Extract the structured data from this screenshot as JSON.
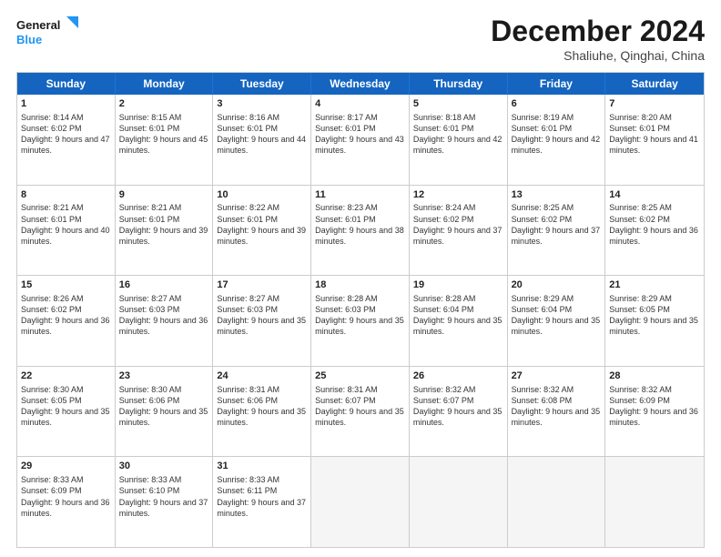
{
  "header": {
    "logo_line1": "General",
    "logo_line2": "Blue",
    "month": "December 2024",
    "location": "Shaliuhe, Qinghai, China"
  },
  "weekdays": [
    "Sunday",
    "Monday",
    "Tuesday",
    "Wednesday",
    "Thursday",
    "Friday",
    "Saturday"
  ],
  "rows": [
    [
      {
        "day": "1",
        "rise": "8:14 AM",
        "set": "6:02 PM",
        "daylight": "9 hours and 47 minutes."
      },
      {
        "day": "2",
        "rise": "8:15 AM",
        "set": "6:01 PM",
        "daylight": "9 hours and 45 minutes."
      },
      {
        "day": "3",
        "rise": "8:16 AM",
        "set": "6:01 PM",
        "daylight": "9 hours and 44 minutes."
      },
      {
        "day": "4",
        "rise": "8:17 AM",
        "set": "6:01 PM",
        "daylight": "9 hours and 43 minutes."
      },
      {
        "day": "5",
        "rise": "8:18 AM",
        "set": "6:01 PM",
        "daylight": "9 hours and 42 minutes."
      },
      {
        "day": "6",
        "rise": "8:19 AM",
        "set": "6:01 PM",
        "daylight": "9 hours and 42 minutes."
      },
      {
        "day": "7",
        "rise": "8:20 AM",
        "set": "6:01 PM",
        "daylight": "9 hours and 41 minutes."
      }
    ],
    [
      {
        "day": "8",
        "rise": "8:21 AM",
        "set": "6:01 PM",
        "daylight": "9 hours and 40 minutes."
      },
      {
        "day": "9",
        "rise": "8:21 AM",
        "set": "6:01 PM",
        "daylight": "9 hours and 39 minutes."
      },
      {
        "day": "10",
        "rise": "8:22 AM",
        "set": "6:01 PM",
        "daylight": "9 hours and 39 minutes."
      },
      {
        "day": "11",
        "rise": "8:23 AM",
        "set": "6:01 PM",
        "daylight": "9 hours and 38 minutes."
      },
      {
        "day": "12",
        "rise": "8:24 AM",
        "set": "6:02 PM",
        "daylight": "9 hours and 37 minutes."
      },
      {
        "day": "13",
        "rise": "8:25 AM",
        "set": "6:02 PM",
        "daylight": "9 hours and 37 minutes."
      },
      {
        "day": "14",
        "rise": "8:25 AM",
        "set": "6:02 PM",
        "daylight": "9 hours and 36 minutes."
      }
    ],
    [
      {
        "day": "15",
        "rise": "8:26 AM",
        "set": "6:02 PM",
        "daylight": "9 hours and 36 minutes."
      },
      {
        "day": "16",
        "rise": "8:27 AM",
        "set": "6:03 PM",
        "daylight": "9 hours and 36 minutes."
      },
      {
        "day": "17",
        "rise": "8:27 AM",
        "set": "6:03 PM",
        "daylight": "9 hours and 35 minutes."
      },
      {
        "day": "18",
        "rise": "8:28 AM",
        "set": "6:03 PM",
        "daylight": "9 hours and 35 minutes."
      },
      {
        "day": "19",
        "rise": "8:28 AM",
        "set": "6:04 PM",
        "daylight": "9 hours and 35 minutes."
      },
      {
        "day": "20",
        "rise": "8:29 AM",
        "set": "6:04 PM",
        "daylight": "9 hours and 35 minutes."
      },
      {
        "day": "21",
        "rise": "8:29 AM",
        "set": "6:05 PM",
        "daylight": "9 hours and 35 minutes."
      }
    ],
    [
      {
        "day": "22",
        "rise": "8:30 AM",
        "set": "6:05 PM",
        "daylight": "9 hours and 35 minutes."
      },
      {
        "day": "23",
        "rise": "8:30 AM",
        "set": "6:06 PM",
        "daylight": "9 hours and 35 minutes."
      },
      {
        "day": "24",
        "rise": "8:31 AM",
        "set": "6:06 PM",
        "daylight": "9 hours and 35 minutes."
      },
      {
        "day": "25",
        "rise": "8:31 AM",
        "set": "6:07 PM",
        "daylight": "9 hours and 35 minutes."
      },
      {
        "day": "26",
        "rise": "8:32 AM",
        "set": "6:07 PM",
        "daylight": "9 hours and 35 minutes."
      },
      {
        "day": "27",
        "rise": "8:32 AM",
        "set": "6:08 PM",
        "daylight": "9 hours and 35 minutes."
      },
      {
        "day": "28",
        "rise": "8:32 AM",
        "set": "6:09 PM",
        "daylight": "9 hours and 36 minutes."
      }
    ],
    [
      {
        "day": "29",
        "rise": "8:33 AM",
        "set": "6:09 PM",
        "daylight": "9 hours and 36 minutes."
      },
      {
        "day": "30",
        "rise": "8:33 AM",
        "set": "6:10 PM",
        "daylight": "9 hours and 37 minutes."
      },
      {
        "day": "31",
        "rise": "8:33 AM",
        "set": "6:11 PM",
        "daylight": "9 hours and 37 minutes."
      },
      null,
      null,
      null,
      null
    ]
  ]
}
